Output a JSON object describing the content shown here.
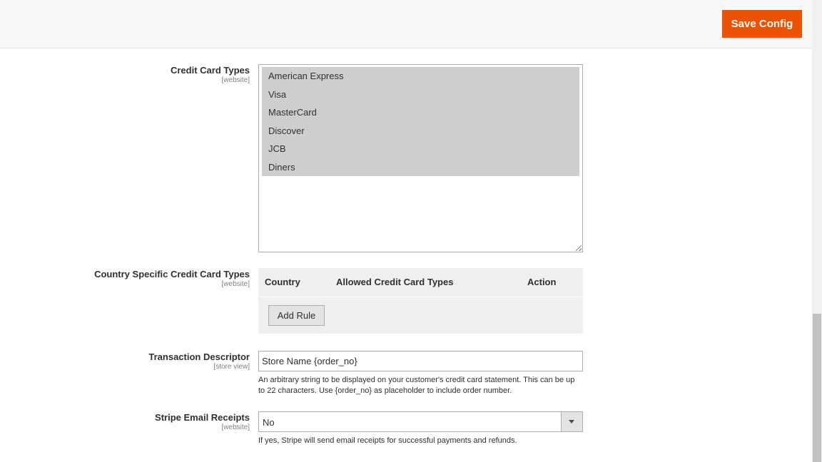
{
  "header": {
    "save_label": "Save Config"
  },
  "credit_card_types": {
    "label": "Credit Card Types",
    "scope": "[website]",
    "options": [
      "American Express",
      "Visa",
      "MasterCard",
      "Discover",
      "JCB",
      "Diners"
    ]
  },
  "country_specific": {
    "label": "Country Specific Credit Card Types",
    "scope": "[website]",
    "columns": [
      "Country",
      "Allowed Credit Card Types",
      "Action"
    ],
    "add_rule_label": "Add Rule"
  },
  "transaction_descriptor": {
    "label": "Transaction Descriptor",
    "scope": "[store view]",
    "value": "Store Name {order_no}",
    "note": "An arbitrary string to be displayed on your customer's credit card statement. This can be up to 22 characters. Use {order_no} as placeholder to include order number."
  },
  "stripe_email_receipts": {
    "label": "Stripe Email Receipts",
    "scope": "[website]",
    "value": "No",
    "note": "If yes, Stripe will send email receipts for successful payments and refunds."
  },
  "colors": {
    "accent": "#eb5202",
    "selected_option": "#cecece",
    "table_bg": "#efefef"
  }
}
